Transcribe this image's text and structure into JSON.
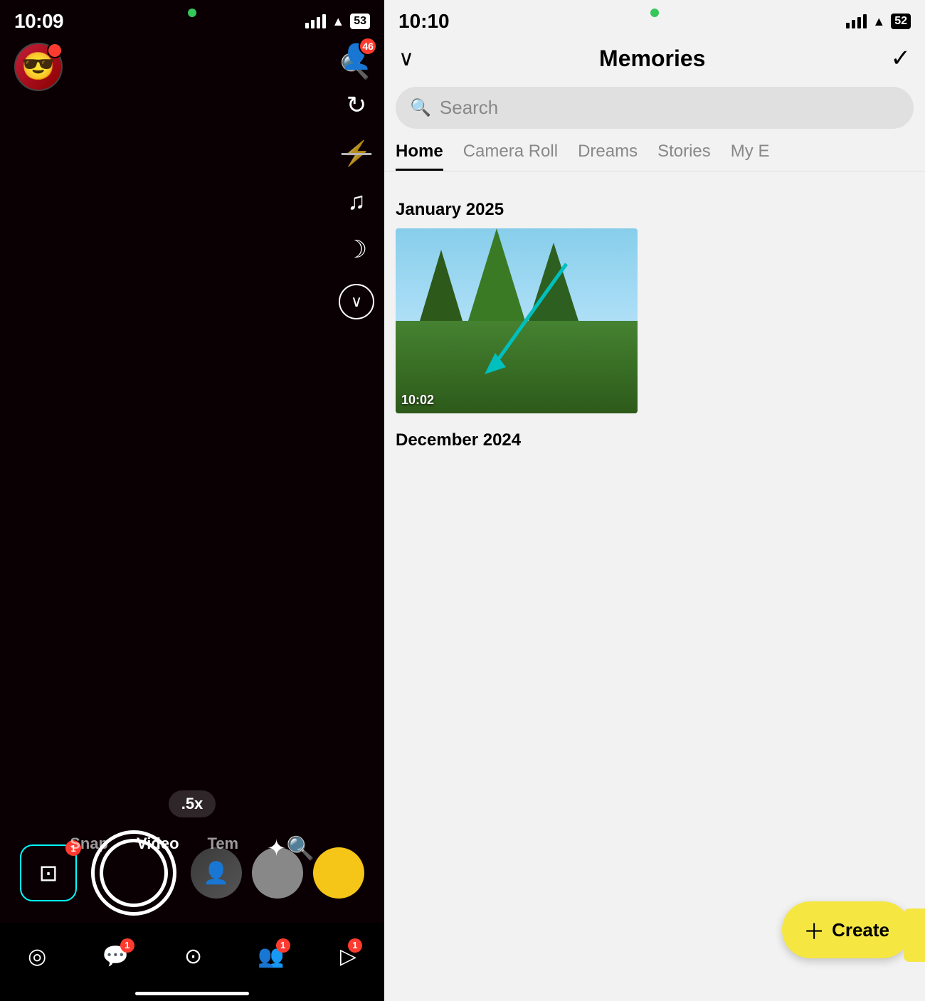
{
  "left": {
    "time": "10:09",
    "battery": "53",
    "zoom": ".5x",
    "avatar_emoji": "😎",
    "mode_options": [
      "Snap",
      "Video",
      "Tem"
    ],
    "active_mode": "Snap",
    "nav_items": [
      "map",
      "chat",
      "camera",
      "friends",
      "stories"
    ],
    "chat_badge": "1",
    "friends_badge": "1",
    "stories_badge": "1",
    "add_friend_badge": "46"
  },
  "right": {
    "time": "10:10",
    "battery": "52",
    "title": "Memories",
    "search_placeholder": "Search",
    "tabs": [
      "Home",
      "Camera Roll",
      "Dreams",
      "Stories",
      "My E"
    ],
    "active_tab": "Home",
    "sections": [
      {
        "label": "January 2025",
        "photos": [
          {
            "timestamp": "10:02"
          }
        ]
      },
      {
        "label": "December 2024",
        "photos": []
      }
    ],
    "create_label": "Create"
  }
}
